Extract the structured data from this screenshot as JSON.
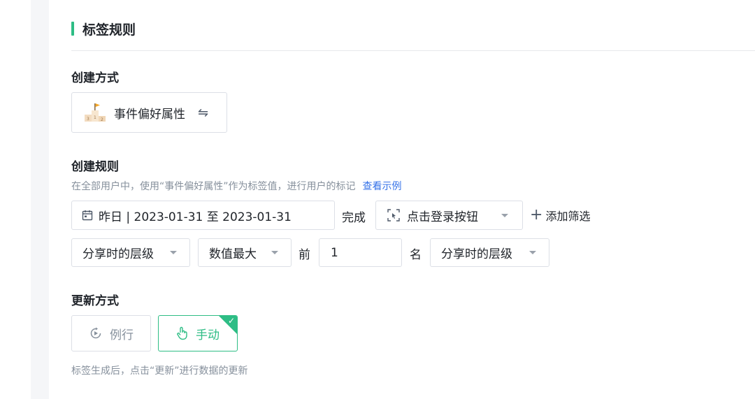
{
  "section": {
    "title": "标签规则"
  },
  "create_method": {
    "label": "创建方式",
    "value": "事件偏好属性",
    "icon": "podium-flag-icon",
    "swap_icon": "swap-icon"
  },
  "create_rule": {
    "label": "创建规则",
    "hint": "在全部用户中，使用“事件偏好属性”作为标签值，进行用户的标记",
    "hint_link": "查看示例",
    "date_range": "昨日 | 2023-01-31 至 2023-01-31",
    "done_text": "完成",
    "event": "点击登录按钮",
    "add_filter": "添加筛选",
    "attr_select": "分享时的层级",
    "agg_select": "数值最大",
    "before_text": "前",
    "rank_value": "1",
    "name_text": "名",
    "attr_select_2": "分享时的层级"
  },
  "update_method": {
    "label": "更新方式",
    "options": [
      {
        "label": "例行",
        "icon": "routine-play-icon",
        "selected": false
      },
      {
        "label": "手动",
        "icon": "hand-pointer-icon",
        "selected": true
      }
    ],
    "hint": "标签生成后，点击“更新”进行数据的更新"
  },
  "colors": {
    "accent": "#2ebd85",
    "link": "#3471e8",
    "muted": "#86909c"
  }
}
